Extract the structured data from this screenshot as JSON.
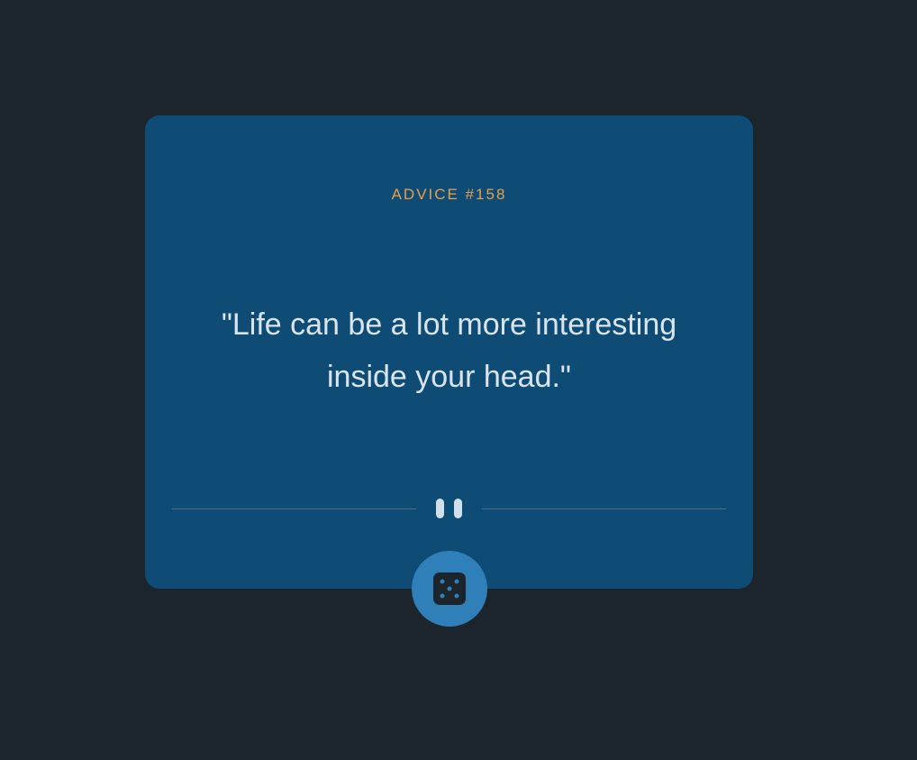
{
  "card": {
    "advice_label": "ADVICE #158",
    "quote": "\"Life can be a lot more interesting inside your head.\""
  },
  "divider": {
    "icon": "pause-icon"
  },
  "action": {
    "icon": "dice-icon"
  },
  "colors": {
    "background": "#1d252c",
    "card": "#0e4c75",
    "accent": "#e8a04a",
    "text": "#d9e4ec",
    "button": "#2f7fb9"
  }
}
